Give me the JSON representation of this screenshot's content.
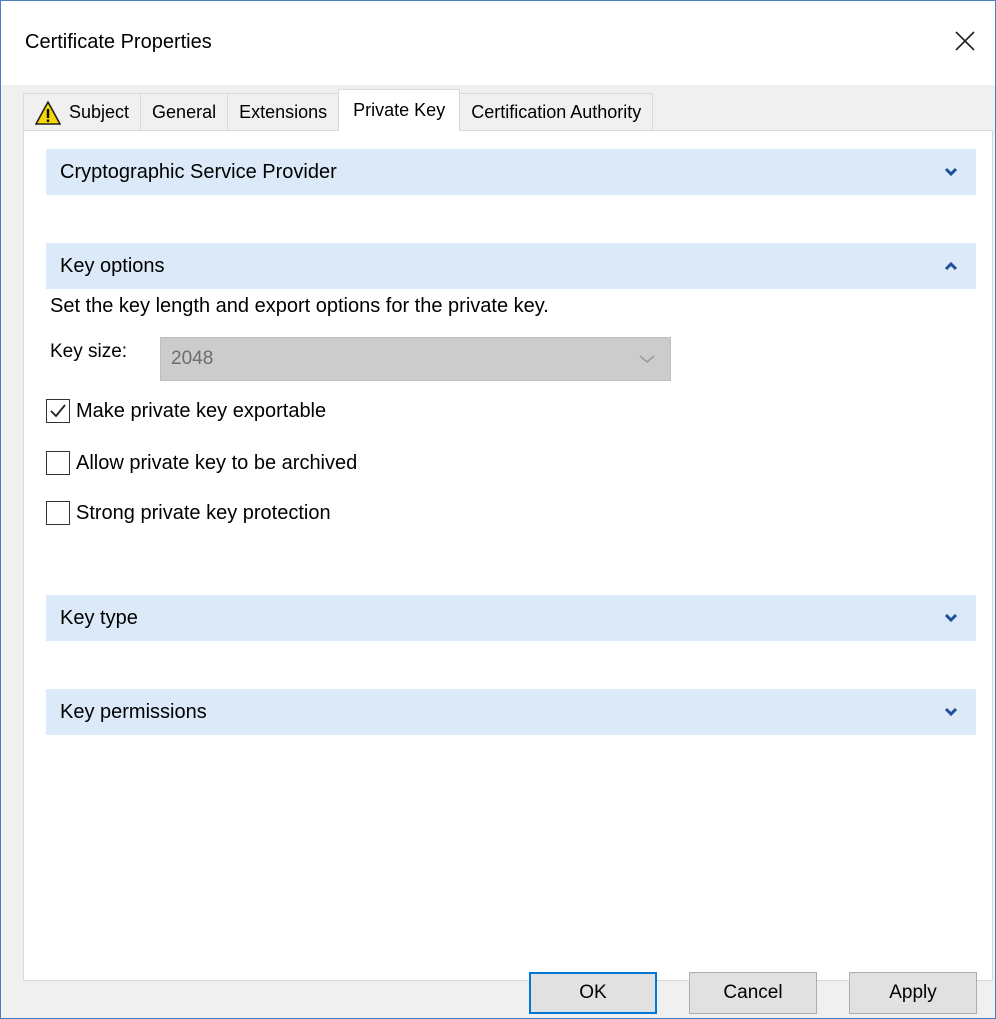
{
  "window": {
    "title": "Certificate Properties",
    "close_glyph": "✕"
  },
  "tabs": [
    {
      "label": "Subject",
      "icon": "warning-icon",
      "active": false
    },
    {
      "label": "General",
      "active": false
    },
    {
      "label": "Extensions",
      "active": false
    },
    {
      "label": "Private Key",
      "active": true
    },
    {
      "label": "Certification Authority",
      "active": false
    }
  ],
  "sections": {
    "csp": {
      "title": "Cryptographic Service Provider",
      "expanded": false
    },
    "key_options": {
      "title": "Key options",
      "expanded": true,
      "description": "Set the key length and export options for the private key.",
      "key_size_label": "Key size:",
      "key_size_value": "2048",
      "checkboxes": [
        {
          "label": "Make private key exportable",
          "checked": true
        },
        {
          "label": "Allow private key to be archived",
          "checked": false
        },
        {
          "label": "Strong private key protection",
          "checked": false
        }
      ]
    },
    "key_type": {
      "title": "Key type",
      "expanded": false
    },
    "key_permissions": {
      "title": "Key permissions",
      "expanded": false
    }
  },
  "buttons": {
    "ok": "OK",
    "cancel": "Cancel",
    "apply": "Apply"
  },
  "colors": {
    "accent": "#0078d7",
    "section_bg": "#dbe9f8",
    "chevron": "#1f4e9a",
    "warning": "#f5d800"
  }
}
